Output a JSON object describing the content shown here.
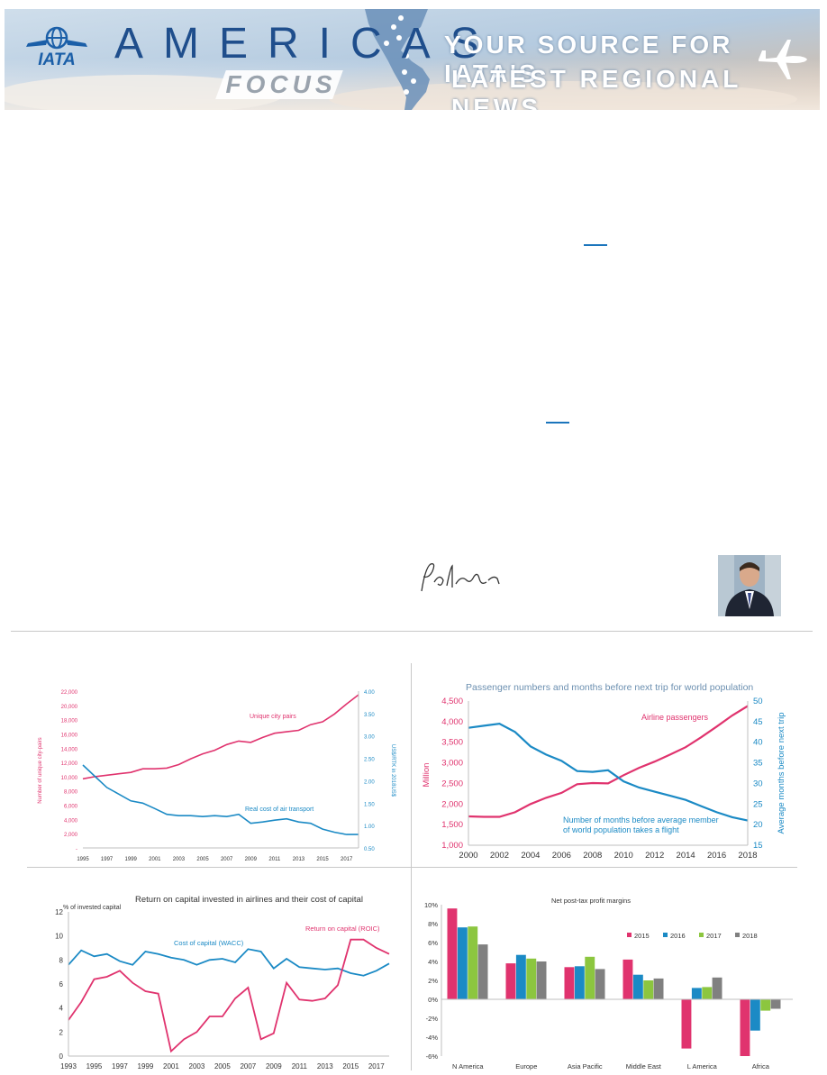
{
  "banner": {
    "logo_text": "IATA",
    "title": "AMERICAS",
    "subtitle": "FOCUS",
    "tagline_line1": "YOUR SOURCE FOR IATA'S",
    "tagline_line2": "LATEST REGIONAL NEWS",
    "colors": {
      "sky": "#b7cfe3",
      "wordmark": "#1f4e8c",
      "logo": "#1b5fa8",
      "accent": "#e8eef5"
    }
  },
  "icons": [
    "globe-icon",
    "airplane-icon",
    "map-pin-icon"
  ],
  "chart_data": [
    {
      "type": "line",
      "title": "",
      "x": [
        "1995",
        "1996",
        "1997",
        "1998",
        "1999",
        "2000",
        "2001",
        "2002",
        "2003",
        "2004",
        "2005",
        "2006",
        "2007",
        "2008",
        "2009",
        "2010",
        "2011",
        "2012",
        "2013",
        "2014",
        "2015",
        "2016",
        "2017",
        "2018"
      ],
      "xticks": [
        "1995",
        "1997",
        "1999",
        "2001",
        "2003",
        "2005",
        "2007",
        "2009",
        "2011",
        "2013",
        "2015",
        "2017"
      ],
      "ylabel": "Number of unique city-pairs",
      "y2label": "US$/RTK in 2018US$",
      "ylim": [
        0,
        22000
      ],
      "yticks": [
        "-",
        "2,000",
        "4,000",
        "6,000",
        "8,000",
        "10,000",
        "12,000",
        "14,000",
        "16,000",
        "18,000",
        "20,000",
        "22,000"
      ],
      "y2lim": [
        0.5,
        4.0
      ],
      "y2ticks": [
        "0.50",
        "1.00",
        "1.50",
        "2.00",
        "2.50",
        "3.00",
        "3.50",
        "4.00"
      ],
      "series": [
        {
          "name": "Unique city pairs",
          "axis": "left",
          "color": "#e0336e",
          "values": [
            9700,
            10000,
            10200,
            10400,
            10600,
            11100,
            11100,
            11200,
            11700,
            12500,
            13200,
            13700,
            14500,
            15000,
            14800,
            15500,
            16100,
            16300,
            16500,
            17300,
            17700,
            18800,
            20200,
            21500
          ]
        },
        {
          "name": "Real cost of air transport",
          "axis": "right",
          "color": "#1b8ac5",
          "values": [
            2.35,
            2.1,
            1.85,
            1.7,
            1.55,
            1.5,
            1.38,
            1.25,
            1.22,
            1.22,
            1.2,
            1.22,
            1.2,
            1.25,
            1.05,
            1.08,
            1.12,
            1.15,
            1.08,
            1.05,
            0.92,
            0.85,
            0.8,
            0.8
          ]
        }
      ]
    },
    {
      "type": "line",
      "title": "Passenger numbers and months before next trip for world population",
      "x": [
        2000,
        2001,
        2002,
        2003,
        2004,
        2005,
        2006,
        2007,
        2008,
        2009,
        2010,
        2011,
        2012,
        2013,
        2014,
        2015,
        2016,
        2017,
        2018
      ],
      "xticks": [
        "2000",
        "2002",
        "2004",
        "2006",
        "2008",
        "2010",
        "2012",
        "2014",
        "2016",
        "2018"
      ],
      "ylabel": "Million",
      "y2label": "Average months before next trip",
      "ylim": [
        1000,
        4500
      ],
      "yticks": [
        "1,000",
        "1,500",
        "2,000",
        "2,500",
        "3,000",
        "3,500",
        "4,000",
        "4,500"
      ],
      "y2lim": [
        15,
        50
      ],
      "y2ticks": [
        "15",
        "20",
        "25",
        "30",
        "35",
        "40",
        "45",
        "50"
      ],
      "series": [
        {
          "name": "Airline passengers",
          "axis": "left",
          "color": "#e0336e",
          "values": [
            1700,
            1690,
            1690,
            1800,
            2000,
            2150,
            2270,
            2480,
            2510,
            2500,
            2700,
            2880,
            3030,
            3200,
            3380,
            3620,
            3880,
            4150,
            4380
          ]
        },
        {
          "name": "Number of months before average member of world population takes a flight",
          "axis": "right",
          "color": "#1b8ac5",
          "values": [
            43.5,
            44,
            44.5,
            42.5,
            39,
            37,
            35.5,
            33,
            32.8,
            33.2,
            30.5,
            29,
            28,
            27,
            26,
            24.5,
            23,
            21.8,
            21
          ]
        }
      ]
    },
    {
      "type": "line",
      "title": "Return on capital invested in airlines and their cost of capital",
      "x": [
        1993,
        1994,
        1995,
        1996,
        1997,
        1998,
        1999,
        2000,
        2001,
        2002,
        2003,
        2004,
        2005,
        2006,
        2007,
        2008,
        2009,
        2010,
        2011,
        2012,
        2013,
        2014,
        2015,
        2016,
        2017,
        2018
      ],
      "xticks": [
        "1993",
        "1995",
        "1997",
        "1999",
        "2001",
        "2003",
        "2005",
        "2007",
        "2009",
        "2011",
        "2013",
        "2015",
        "2017"
      ],
      "ylabel": "% of invested capital",
      "ylim": [
        0,
        12
      ],
      "yticks": [
        "0",
        "2",
        "4",
        "6",
        "8",
        "10",
        "12"
      ],
      "series": [
        {
          "name": "Cost of capital (WACC)",
          "color": "#1b8ac5",
          "values": [
            7.6,
            8.8,
            8.3,
            8.5,
            7.9,
            7.6,
            8.7,
            8.5,
            8.2,
            8.0,
            7.6,
            8.0,
            8.1,
            7.8,
            8.9,
            8.7,
            7.3,
            8.1,
            7.4,
            7.3,
            7.2,
            7.3,
            6.9,
            6.7,
            7.1,
            7.7
          ]
        },
        {
          "name": "Return on capital (ROIC)",
          "color": "#e0336e",
          "values": [
            3.0,
            4.5,
            6.4,
            6.6,
            7.1,
            6.1,
            5.4,
            5.2,
            0.4,
            1.4,
            2.0,
            3.3,
            3.3,
            4.8,
            5.7,
            1.4,
            1.9,
            6.1,
            4.7,
            4.6,
            4.8,
            5.9,
            9.7,
            9.7,
            9.0,
            8.5
          ]
        }
      ]
    },
    {
      "type": "bar",
      "title": "Net post-tax profit margins",
      "categories": [
        "N America",
        "Europe",
        "Asia Pacific",
        "Middle East",
        "L America",
        "Africa"
      ],
      "ylim": [
        -6,
        10
      ],
      "yticks": [
        "-6%",
        "-4%",
        "-2%",
        "0%",
        "2%",
        "4%",
        "6%",
        "8%",
        "10%"
      ],
      "legend": "top-right",
      "series": [
        {
          "name": "2015",
          "color": "#e0336e",
          "values": [
            9.6,
            3.8,
            3.4,
            4.2,
            -5.2,
            -6.0
          ]
        },
        {
          "name": "2016",
          "color": "#1b8ac5",
          "values": [
            7.6,
            4.7,
            3.5,
            2.6,
            1.2,
            -3.3
          ]
        },
        {
          "name": "2017",
          "color": "#8cc63f",
          "values": [
            7.7,
            4.3,
            4.5,
            2.0,
            1.3,
            -1.2
          ]
        },
        {
          "name": "2018",
          "color": "#808080",
          "values": [
            5.8,
            4.0,
            3.2,
            2.2,
            2.3,
            -1.0
          ]
        }
      ]
    }
  ]
}
